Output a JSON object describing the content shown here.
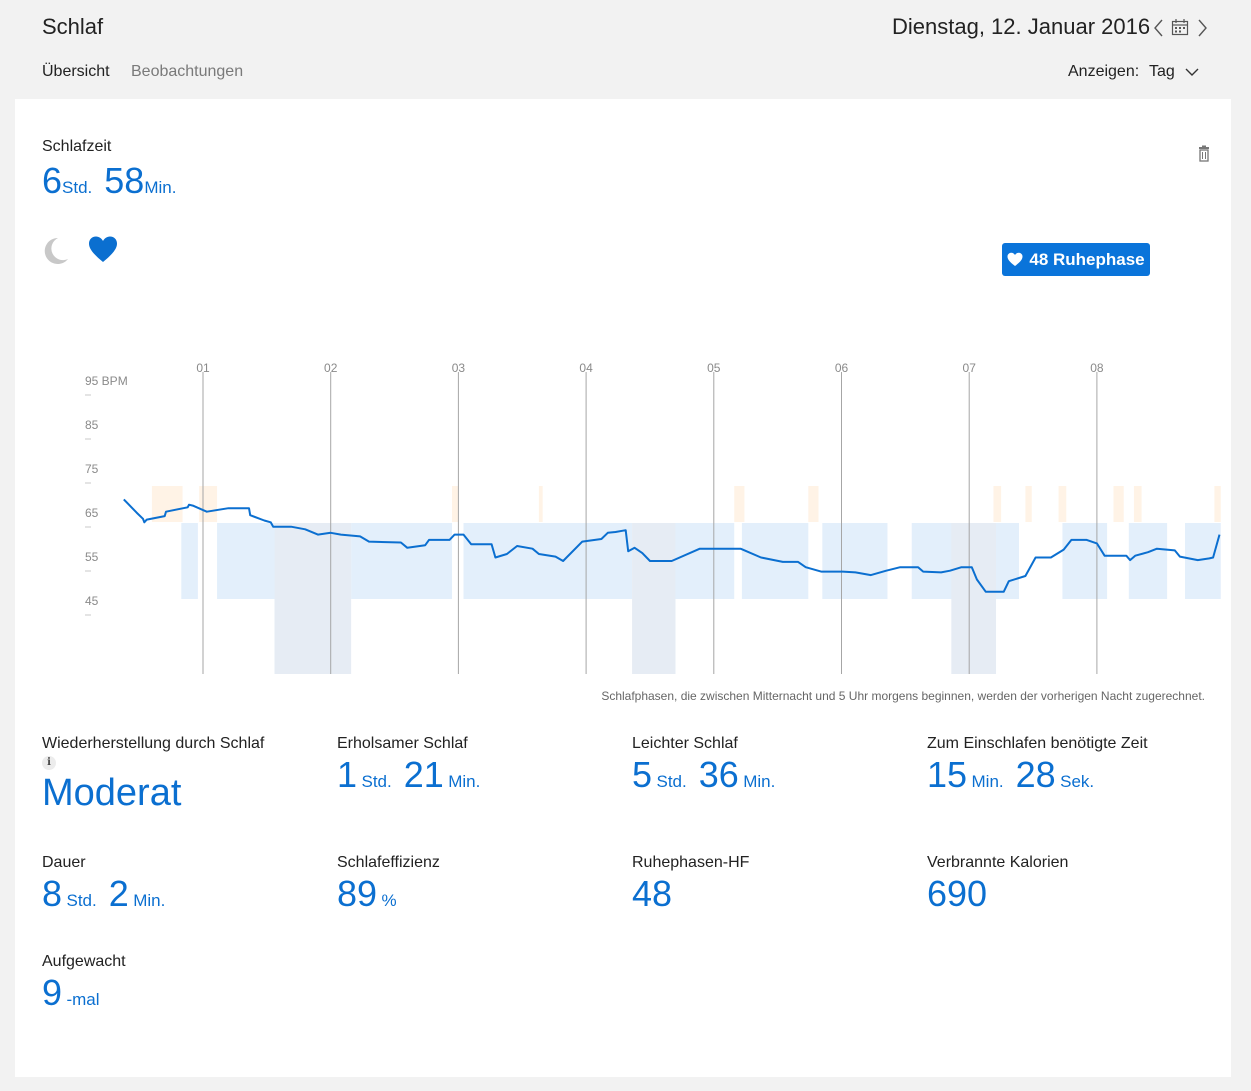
{
  "header": {
    "app_title": "Schlaf",
    "date": "Dienstag, 12. Januar 2016"
  },
  "tabs": [
    {
      "label": "Übersicht",
      "active": true
    },
    {
      "label": "Beobachtungen",
      "active": false
    }
  ],
  "view": {
    "label": "Anzeigen:",
    "value": "Tag"
  },
  "summary": {
    "label": "Schlafzeit",
    "hours": "6",
    "hours_unit": "Std.",
    "minutes": "58",
    "minutes_unit": "Min."
  },
  "badge": {
    "label": "48 Ruhephase"
  },
  "footnote": "Schlafphasen, die zwischen Mitternacht und 5 Uhr morgens beginnen, werden der vorherigen Nacht zugerechnet.",
  "metrics": {
    "recovery": {
      "label": "Wiederherstellung durch Schlaf",
      "value": "Moderat"
    },
    "restful": {
      "label": "Erholsamer Schlaf",
      "v1": "1",
      "u1": "Std.",
      "v2": "21",
      "u2": "Min."
    },
    "light": {
      "label": "Leichter Schlaf",
      "v1": "5",
      "u1": "Std.",
      "v2": "36",
      "u2": "Min."
    },
    "fall_asleep": {
      "label": "Zum Einschlafen benötigte Zeit",
      "v1": "15",
      "u1": "Min.",
      "v2": "28",
      "u2": "Sek."
    },
    "duration": {
      "label": "Dauer",
      "v1": "8",
      "u1": "Std.",
      "v2": "2",
      "u2": "Min."
    },
    "efficiency": {
      "label": "Schlafeffizienz",
      "v1": "89",
      "u1": "%"
    },
    "resting_hr": {
      "label": "Ruhephasen-HF",
      "v1": "48"
    },
    "calories": {
      "label": "Verbrannte Kalorien",
      "v1": "690"
    },
    "woke": {
      "label": "Aufgewacht",
      "v1": "9",
      "u1": "-mal"
    }
  },
  "colors": {
    "accent": "#0a74da",
    "line": "#0b6fd0",
    "light_sleep": "#e3effb",
    "restful_sleep": "#e6ecf4",
    "awake": "#fff3e6"
  },
  "icons": {
    "moon": "moon-icon",
    "heart": "heart-icon",
    "trash": "trash-icon",
    "calendar": "calendar-icon",
    "info": "info-icon"
  },
  "chart_data": {
    "type": "line",
    "hour_labels": [
      "01",
      "02",
      "03",
      "04",
      "05",
      "06",
      "07",
      "08"
    ],
    "x_hours": [
      0.0,
      1.0,
      2.0,
      3.0,
      4.0,
      5.0,
      6.0,
      7.0
    ],
    "ylabel": "BPM",
    "y_ticks": [
      "95 BPM",
      "85",
      "75",
      "65",
      "55",
      "45"
    ],
    "y_tick_values": [
      95,
      85,
      75,
      65,
      55,
      45
    ],
    "x_range_hours": [
      -0.62,
      7.38
    ],
    "y_range": [
      45,
      95
    ],
    "series": [
      {
        "values": [
          [
            -0.62,
            69.0
          ],
          [
            -0.52,
            66.0
          ],
          [
            -0.47,
            64.6
          ],
          [
            -0.46,
            63.8
          ],
          [
            -0.44,
            64.4
          ],
          [
            -0.3,
            65.2
          ],
          [
            -0.29,
            66.2
          ],
          [
            -0.12,
            67.2
          ],
          [
            -0.11,
            67.8
          ],
          [
            -0.08,
            67.6
          ],
          [
            0.03,
            66.2
          ],
          [
            0.2,
            67.0
          ],
          [
            0.36,
            67.0
          ],
          [
            0.37,
            65.4
          ],
          [
            0.48,
            64.2
          ],
          [
            0.53,
            63.8
          ],
          [
            0.55,
            62.8
          ],
          [
            0.69,
            62.8
          ],
          [
            0.8,
            62.2
          ],
          [
            0.9,
            61.0
          ],
          [
            1.0,
            61.4
          ],
          [
            1.08,
            61.0
          ],
          [
            1.23,
            60.6
          ],
          [
            1.3,
            59.4
          ],
          [
            1.55,
            59.2
          ],
          [
            1.6,
            58.0
          ],
          [
            1.74,
            58.6
          ],
          [
            1.77,
            59.8
          ],
          [
            1.93,
            59.8
          ],
          [
            1.97,
            61.0
          ],
          [
            2.04,
            61.0
          ],
          [
            2.1,
            58.8
          ],
          [
            2.26,
            58.8
          ],
          [
            2.29,
            55.8
          ],
          [
            2.38,
            56.6
          ],
          [
            2.46,
            58.4
          ],
          [
            2.58,
            57.8
          ],
          [
            2.63,
            56.6
          ],
          [
            2.76,
            56.0
          ],
          [
            2.82,
            55.0
          ],
          [
            2.97,
            59.4
          ],
          [
            3.12,
            60.0
          ],
          [
            3.17,
            61.4
          ],
          [
            3.23,
            61.6
          ],
          [
            3.31,
            62.0
          ],
          [
            3.33,
            57.2
          ],
          [
            3.38,
            58.0
          ],
          [
            3.44,
            56.8
          ],
          [
            3.5,
            55.0
          ],
          [
            3.67,
            55.0
          ],
          [
            3.89,
            57.8
          ],
          [
            4.06,
            57.8
          ],
          [
            4.21,
            57.8
          ],
          [
            4.37,
            55.8
          ],
          [
            4.54,
            54.8
          ],
          [
            4.66,
            54.8
          ],
          [
            4.72,
            53.6
          ],
          [
            4.84,
            52.6
          ],
          [
            5.01,
            52.6
          ],
          [
            5.11,
            52.4
          ],
          [
            5.23,
            51.8
          ],
          [
            5.35,
            52.8
          ],
          [
            5.46,
            53.6
          ],
          [
            5.6,
            53.6
          ],
          [
            5.64,
            52.6
          ],
          [
            5.78,
            52.4
          ],
          [
            5.85,
            52.8
          ],
          [
            5.94,
            53.6
          ],
          [
            6.02,
            53.6
          ],
          [
            6.06,
            50.8
          ],
          [
            6.13,
            48.0
          ],
          [
            6.27,
            48.0
          ],
          [
            6.31,
            50.4
          ],
          [
            6.44,
            51.6
          ],
          [
            6.52,
            55.8
          ],
          [
            6.64,
            55.8
          ],
          [
            6.74,
            57.6
          ],
          [
            6.8,
            59.8
          ],
          [
            6.92,
            59.8
          ],
          [
            7.0,
            59.0
          ],
          [
            7.06,
            56.2
          ],
          [
            7.23,
            56.2
          ],
          [
            7.26,
            55.2
          ],
          [
            7.3,
            56.2
          ],
          [
            7.4,
            57.0
          ],
          [
            7.47,
            57.8
          ],
          [
            7.61,
            57.4
          ],
          [
            7.65,
            56.0
          ],
          [
            7.79,
            55.2
          ],
          [
            7.88,
            55.6
          ],
          [
            7.91,
            55.8
          ],
          [
            7.96,
            61.0
          ]
        ]
      }
    ],
    "phases": {
      "light": [
        [
          -0.17,
          -0.04
        ],
        [
          0.11,
          0.56
        ],
        [
          1.16,
          1.95
        ],
        [
          2.04,
          3.36
        ],
        [
          3.7,
          4.16
        ],
        [
          4.22,
          4.74
        ],
        [
          4.85,
          5.36
        ],
        [
          5.55,
          6.39
        ],
        [
          6.73,
          7.08
        ],
        [
          7.25,
          7.55
        ],
        [
          7.69,
          7.97
        ]
      ],
      "restful": [
        [
          0.56,
          1.16
        ],
        [
          3.36,
          3.7
        ],
        [
          5.86,
          6.21
        ]
      ],
      "awake": [
        [
          -0.4,
          -0.16
        ],
        [
          -0.03,
          0.11
        ],
        [
          1.95,
          2.0
        ],
        [
          2.63,
          2.66
        ],
        [
          4.16,
          4.24
        ],
        [
          4.74,
          4.82
        ],
        [
          6.19,
          6.25
        ],
        [
          6.44,
          6.49
        ],
        [
          6.7,
          6.76
        ],
        [
          7.13,
          7.21
        ],
        [
          7.29,
          7.35
        ],
        [
          7.92,
          7.97
        ]
      ]
    }
  }
}
